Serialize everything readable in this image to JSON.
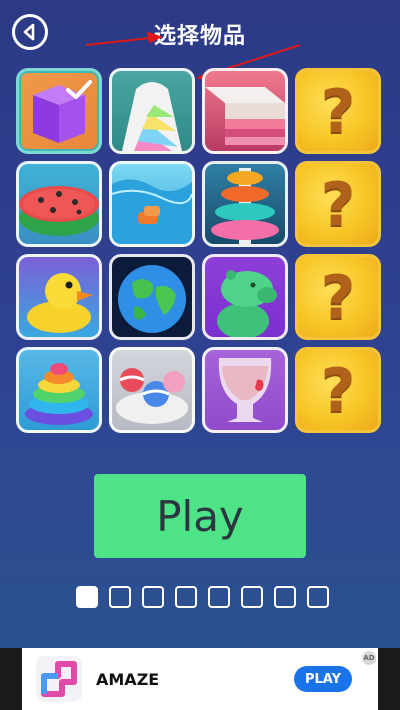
{
  "header": {
    "title": "选择物品"
  },
  "items": [
    {
      "name": "purple-cube",
      "state": "selected"
    },
    {
      "name": "rainbow-arch",
      "state": "unlocked"
    },
    {
      "name": "layered-cake-block",
      "state": "unlocked"
    },
    {
      "name": "locked",
      "state": "locked",
      "label": "?"
    },
    {
      "name": "watermelon",
      "state": "unlocked"
    },
    {
      "name": "pool-water",
      "state": "unlocked"
    },
    {
      "name": "spiral-tower",
      "state": "unlocked"
    },
    {
      "name": "locked",
      "state": "locked",
      "label": "?"
    },
    {
      "name": "rubber-duck",
      "state": "unlocked"
    },
    {
      "name": "earth-globe",
      "state": "unlocked"
    },
    {
      "name": "green-capybara",
      "state": "unlocked"
    },
    {
      "name": "locked",
      "state": "locked",
      "label": "?"
    },
    {
      "name": "rainbow-swirl",
      "state": "unlocked"
    },
    {
      "name": "ball-bowl",
      "state": "unlocked"
    },
    {
      "name": "strawberry-smoothie",
      "state": "unlocked"
    },
    {
      "name": "locked",
      "state": "locked",
      "label": "?"
    }
  ],
  "play_button": {
    "label": "Play"
  },
  "pagination": {
    "total_pages": 8,
    "active_page": 1
  },
  "ad": {
    "app_name": "AMAZE",
    "cta": "PLAY",
    "badge": "AD"
  },
  "colors": {
    "play_green": "#4ee387",
    "ad_cta_blue": "#1a73e8",
    "selected_border": "#7ed8d6",
    "locked_gold": "#f7c626",
    "annotation_red": "#e01818"
  }
}
